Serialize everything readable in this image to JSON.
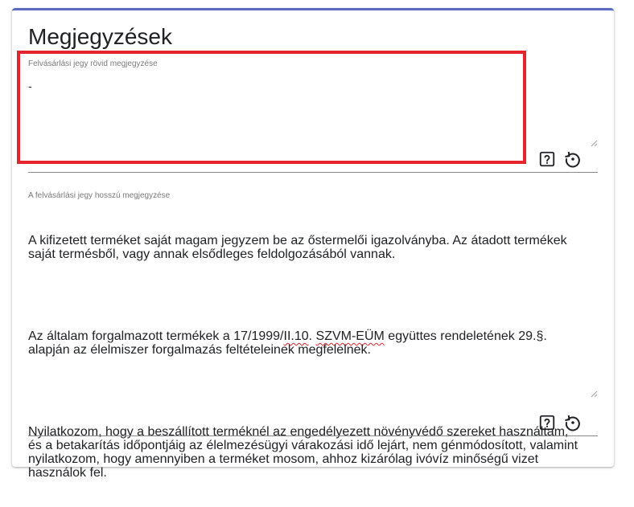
{
  "card": {
    "title": "Megjegyzések"
  },
  "short_note": {
    "label": "Felvásárlási jegy rövid megjegyzése",
    "value": "-",
    "help_icon": "help-box-icon",
    "reset_icon": "restore-icon"
  },
  "long_note": {
    "label": "A felvásárlási jegy hosszú megjegyzése",
    "paragraph_1": "A kifizetett terméket saját magam jegyzem be az őstermelői igazolványba. Az átadott termékek saját termésből, vagy annak elsődleges feldolgozásából vannak.",
    "paragraph_2_pre": "Az általam forgalmazott termékek a 17/1999/",
    "paragraph_2_u1": "II.10",
    "paragraph_2_mid": ". ",
    "paragraph_2_u2": "SZVM-EÜM",
    "paragraph_2_post": " együttes rendeletének 29.§. alapján az élelmiszer forgalmazás feltételeinek megfelelnek.",
    "paragraph_3": "Nyilatkozom, hogy a beszállított terméknél az engedélyezett növényvédő szereket használtam, és a betakarítás időpontjáig az élelmezésügyi várakozási idő lejárt, nem génmódosított, valamint nyilatkozom, hogy amennyiben a terméket mosom, ahhoz kizárólag ivóvíz minőségű vizet használok fel.",
    "help_icon": "help-box-icon",
    "reset_icon": "restore-icon"
  },
  "colors": {
    "accent": "#5c6bc0",
    "highlight": "#e5242e",
    "label": "#7a7a7a",
    "text": "#202124"
  }
}
